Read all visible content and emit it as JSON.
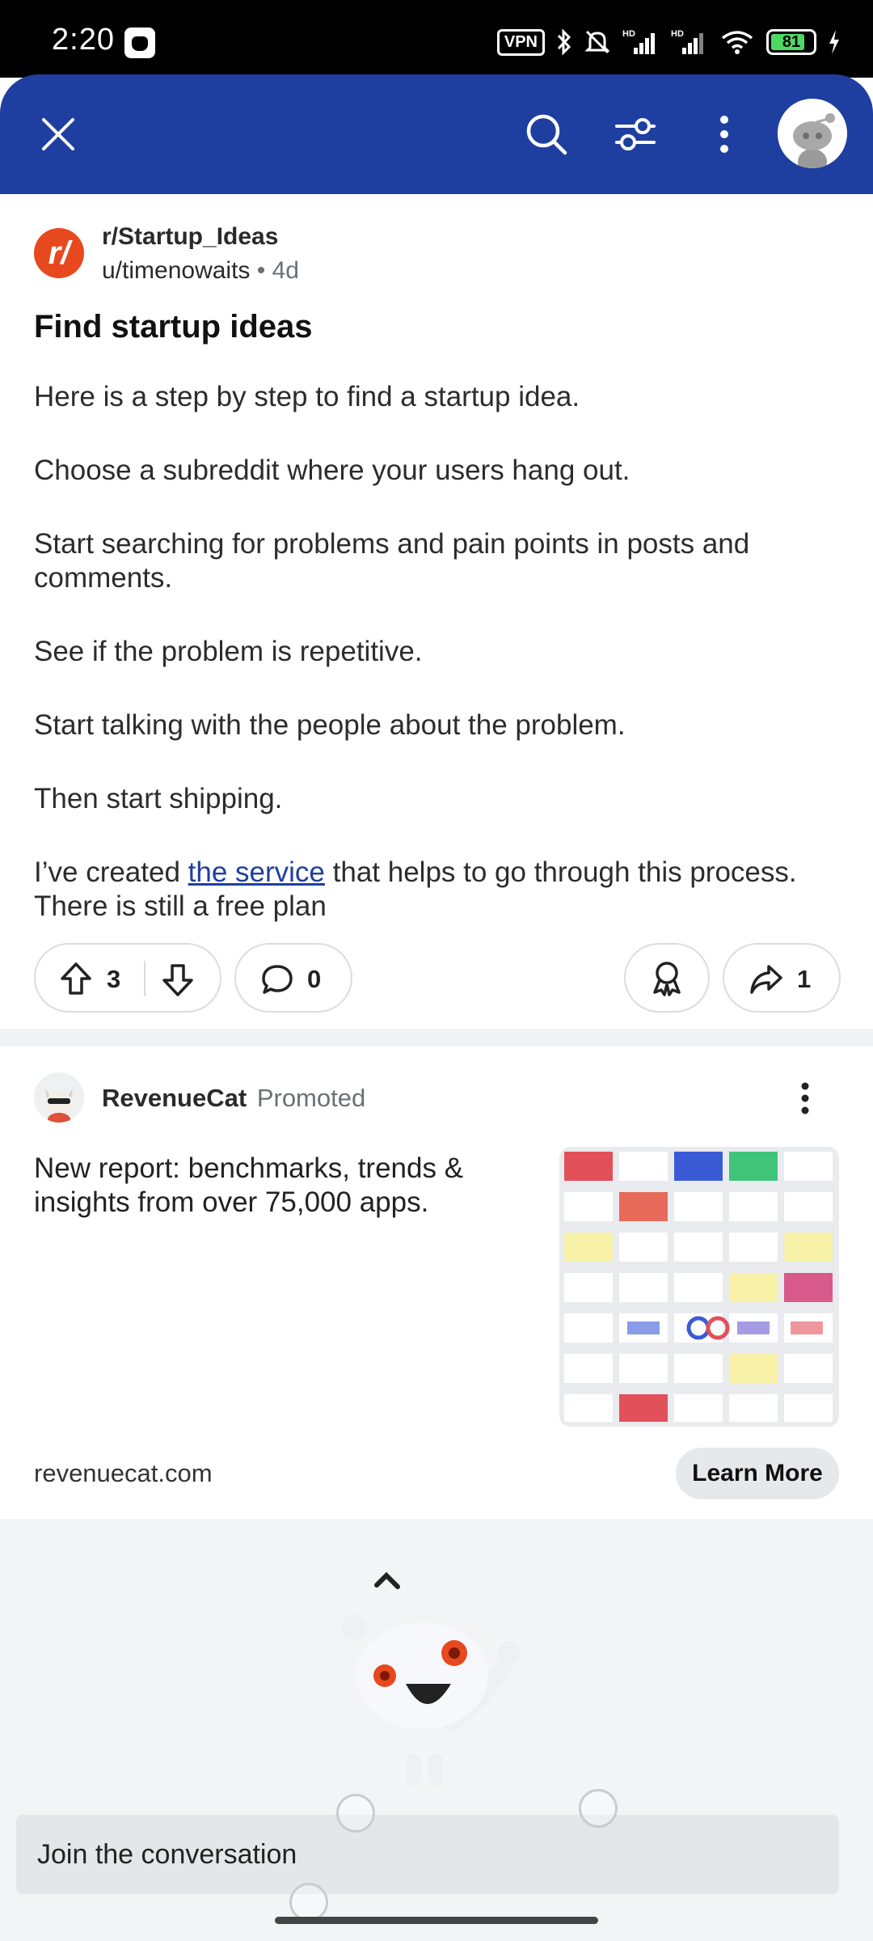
{
  "status_bar": {
    "time": "2:20",
    "vpn_label": "VPN",
    "battery_percent": "81",
    "battery_level": 0.81,
    "icons": [
      "app-cat-icon",
      "vpn-icon",
      "bluetooth-icon",
      "mute-icon",
      "signal-hd-icon",
      "signal-hd-icon",
      "wifi-icon",
      "battery-icon",
      "charging-icon"
    ]
  },
  "app_bar": {
    "background_color": "#1f3fa0",
    "icons": [
      "close-icon",
      "search-icon",
      "filter-icon",
      "more-vertical-icon",
      "avatar-icon"
    ]
  },
  "post": {
    "subreddit": "r/Startup_Ideas",
    "author": "u/timenowaits",
    "separator": " • ",
    "age": "4d",
    "title": "Find startup ideas",
    "body": {
      "p1": "Here is a step by step to find a startup idea.",
      "p2": "Choose a subreddit where your users hang out.",
      "p3": "Start searching for problems and pain points in posts and comments.",
      "p4": "See if the problem is repetitive.",
      "p5": "Start talking with the people about the problem.",
      "p6": "Then start shipping.",
      "p7_before": "I’ve created ",
      "p7_link": "the service",
      "p7_after": " that helps to go through this process. There is still a free plan"
    },
    "upvotes": "3",
    "comments": "0",
    "shares": "1"
  },
  "ad": {
    "advertiser": "RevenueCat",
    "promoted_label": "Promoted",
    "text": "New report: benchmarks, trends & insights from over 75,000 apps.",
    "domain": "revenuecat.com",
    "cta": "Learn More"
  },
  "comment_bar": {
    "placeholder": "Join the conversation"
  },
  "colors": {
    "brand_blue": "#1f3fa0",
    "reddit_orange": "#e8481e",
    "link": "#1f3fa0"
  }
}
